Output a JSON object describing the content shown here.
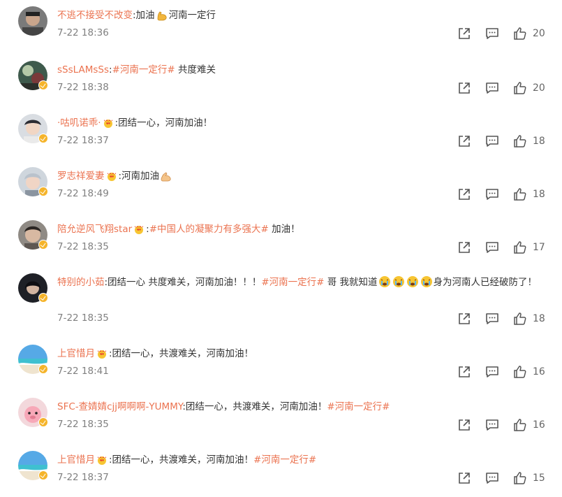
{
  "comments": [
    {
      "username": "不逃不接受不改变",
      "segments": [
        {
          "t": ":加油",
          "c": "text"
        },
        {
          "e": "strong"
        },
        {
          "t": "河南一定行",
          "c": "text"
        }
      ],
      "time": "7-22 18:36",
      "likes": "20",
      "verified": false,
      "avatar": "avatar-1"
    },
    {
      "username": "sSsLAMsSs",
      "segments": [
        {
          "t": ":",
          "c": "text"
        },
        {
          "t": "#河南一定行#",
          "c": "tag"
        },
        {
          "t": " 共度难关",
          "c": "text"
        }
      ],
      "time": "7-22 18:38",
      "likes": "20",
      "verified": true,
      "avatar": "avatar-2"
    },
    {
      "username": "·咕叽诺乖·",
      "segments": [
        {
          "e": "crown"
        },
        {
          "t": ":团结一心，河南加油！",
          "c": "text"
        }
      ],
      "time": "7-22 18:37",
      "likes": "18",
      "verified": true,
      "avatar": "avatar-3"
    },
    {
      "username": "罗志祥爱妻",
      "segments": [
        {
          "e": "crown"
        },
        {
          "t": ":河南加油",
          "c": "text"
        },
        {
          "e": "muscle"
        }
      ],
      "time": "7-22 18:49",
      "likes": "18",
      "verified": true,
      "avatar": "avatar-4"
    },
    {
      "username": "陪允逆风飞翔star",
      "segments": [
        {
          "e": "crown"
        },
        {
          "t": ":",
          "c": "text"
        },
        {
          "t": "#中国人的凝聚力有多强大#",
          "c": "tag"
        },
        {
          "t": " 加油！",
          "c": "text"
        }
      ],
      "time": "7-22 18:35",
      "likes": "17",
      "verified": true,
      "avatar": "avatar-5"
    },
    {
      "username": "特别的小茹",
      "segments": [
        {
          "t": ":团结一心 共度难关，河南加油！！！",
          "c": "text"
        },
        {
          "t": "#河南一定行#",
          "c": "tag"
        },
        {
          "t": " 哥 我就知道",
          "c": "text"
        },
        {
          "e": "cry"
        },
        {
          "e": "cry"
        },
        {
          "e": "cry"
        },
        {
          "e": "cry"
        },
        {
          "t": "身为河南人已经破防了！",
          "c": "text"
        }
      ],
      "time": "7-22 18:35",
      "likes": "18",
      "verified": true,
      "avatar": "avatar-6"
    },
    {
      "username": "上官惜月",
      "segments": [
        {
          "e": "crown"
        },
        {
          "t": ":团结一心，共渡难关，河南加油！",
          "c": "text"
        }
      ],
      "time": "7-22 18:41",
      "likes": "16",
      "verified": true,
      "avatar": "avatar-beach"
    },
    {
      "username": "SFC-查婧婧cjj啊啊啊-YUMMY",
      "segments": [
        {
          "t": ":团结一心，共渡难关，河南加油！",
          "c": "text"
        },
        {
          "t": "#河南一定行#",
          "c": "tag"
        }
      ],
      "time": "7-22 18:35",
      "likes": "16",
      "verified": true,
      "avatar": "avatar-8"
    },
    {
      "username": "上官惜月",
      "segments": [
        {
          "e": "crown"
        },
        {
          "t": ":团结一心，共渡难关，河南加油！",
          "c": "text"
        },
        {
          "t": "#河南一定行#",
          "c": "tag"
        }
      ],
      "time": "7-22 18:37",
      "likes": "15",
      "verified": true,
      "avatar": "avatar-beach"
    }
  ],
  "colors": {
    "username": "#eb7350",
    "topic": "#eb7350",
    "text": "#333333",
    "meta": "#808080",
    "badge": "#f5b42a"
  },
  "icons": {
    "share": "share-icon",
    "reply": "comment-icon",
    "like": "thumbs-up-icon",
    "verified": "verified-badge-icon"
  }
}
